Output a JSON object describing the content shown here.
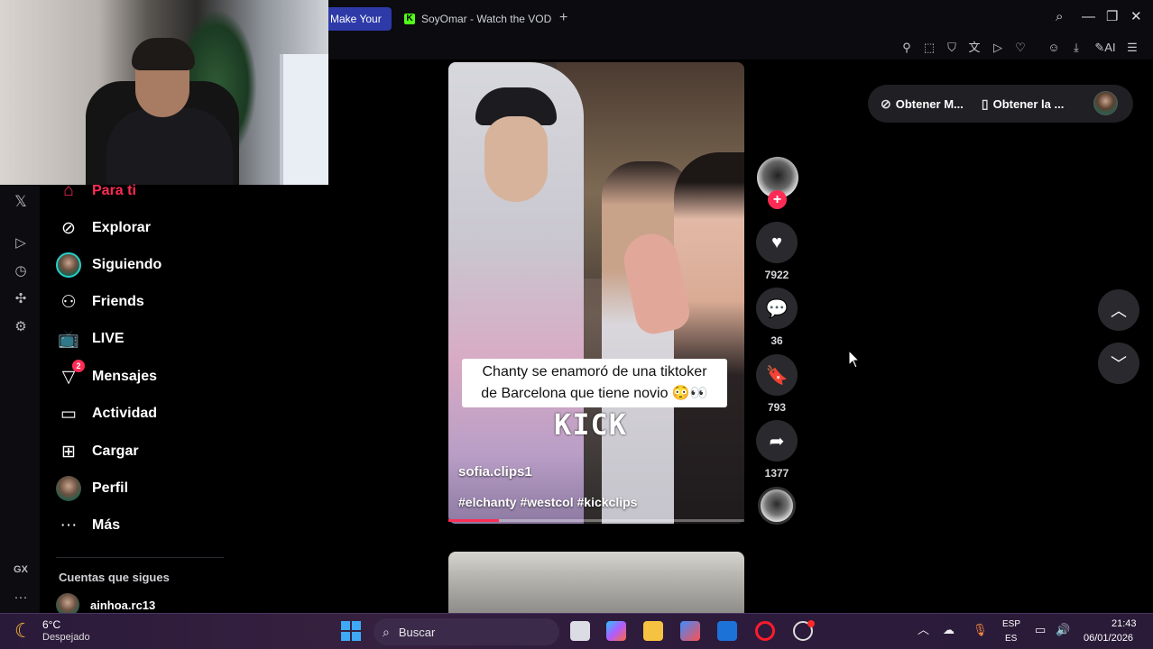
{
  "browser": {
    "tabs": [
      {
        "label": "Make Your",
        "active": true
      },
      {
        "label": "SoyOmar - Watch the VOD",
        "active": false,
        "favicon": "K"
      }
    ],
    "new_tab": "+",
    "toolbar_icons": [
      "pin-icon",
      "snapshot-icon",
      "shield-icon",
      "translate-icon",
      "send-icon",
      "heart-icon",
      "profile-icon",
      "download-icon",
      "ai-icon",
      "menu-icon"
    ],
    "ai_label": "AI"
  },
  "sidebar": {
    "items": [
      {
        "label": "Para ti",
        "icon": "home-icon",
        "active": true
      },
      {
        "label": "Explorar",
        "icon": "compass-icon"
      },
      {
        "label": "Siguiendo",
        "icon": "following-avatar"
      },
      {
        "label": "Friends",
        "icon": "friends-icon"
      },
      {
        "label": "LIVE",
        "icon": "live-icon"
      },
      {
        "label": "Mensajes",
        "icon": "messages-icon",
        "badge": "2"
      },
      {
        "label": "Actividad",
        "icon": "activity-icon"
      },
      {
        "label": "Cargar",
        "icon": "upload-icon"
      },
      {
        "label": "Perfil",
        "icon": "profile-avatar"
      },
      {
        "label": "Más",
        "icon": "more-icon"
      }
    ],
    "following_header": "Cuentas que sigues",
    "following": [
      {
        "name": "ainhoa.rc13"
      }
    ]
  },
  "video": {
    "caption_line1": "Chanty se enamoró de una tiktoker",
    "caption_line2": "de Barcelona que tiene novio 😳👀",
    "watermark": "KICK",
    "author": "sofia.clips1",
    "hashtags": "#elchanty #westcol #kickclips",
    "progress": 0.17
  },
  "actions": {
    "likes": "7922",
    "comments": "36",
    "saves": "793",
    "shares": "1377"
  },
  "get_app": {
    "btn1": "Obtener M...",
    "btn2": "Obtener la ..."
  },
  "taskbar": {
    "temperature": "6°C",
    "weather": "Despejado",
    "search_placeholder": "Buscar",
    "lang_top": "ESP",
    "lang_bottom": "ES",
    "time": "21:43",
    "date": "06/01/2026"
  },
  "colors": {
    "accent": "#fe2c55",
    "kick_green": "#53fc18",
    "active_tab": "#2d3aa8"
  }
}
